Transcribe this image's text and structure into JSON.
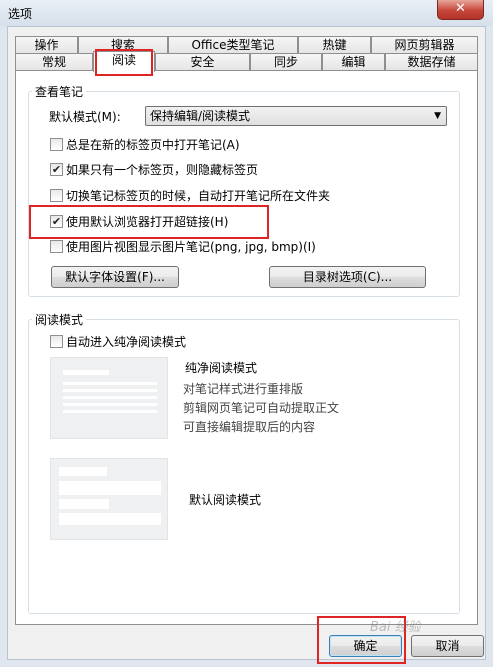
{
  "window": {
    "title": "选项",
    "close_symbol": "✕"
  },
  "tabs_row1": [
    "操作",
    "搜索",
    "Office类型笔记",
    "热键",
    "网页剪辑器"
  ],
  "tabs_row2": [
    "常规",
    "阅读",
    "安全",
    "同步",
    "编辑",
    "数据存储"
  ],
  "active_tab": "阅读",
  "view_group": {
    "title": "查看笔记",
    "default_mode_label": "默认模式(M):",
    "default_mode_value": "保持编辑/阅读模式",
    "checkboxes": [
      {
        "label": "总是在新的标签页中打开笔记(A)",
        "checked": false
      },
      {
        "label": "如果只有一个标签页，则隐藏标签页",
        "checked": true
      },
      {
        "label": "切换笔记标签页的时候，自动打开笔记所在文件夹",
        "checked": false
      },
      {
        "label": "使用默认浏览器打开超链接(H)",
        "checked": true
      },
      {
        "label": "使用图片视图显示图片笔记(png, jpg, bmp)(I)",
        "checked": false
      }
    ],
    "font_button": "默认字体设置(F)...",
    "tree_button": "目录树选项(C)..."
  },
  "reading_group": {
    "title": "阅读模式",
    "auto_checkbox": {
      "label": "自动进入纯净阅读模式",
      "checked": false
    },
    "pure_mode_title": "纯净阅读模式",
    "pure_mode_desc": [
      "对笔记样式进行重排版",
      "剪辑网页笔记可自动提取正文",
      "可直接编辑提取后的内容"
    ],
    "default_mode_title": "默认阅读模式"
  },
  "footer": {
    "ok": "确定",
    "cancel": "取消"
  },
  "watermark": "Bai 经验",
  "colors": {
    "highlight": "#e02424",
    "check": "#222222"
  }
}
